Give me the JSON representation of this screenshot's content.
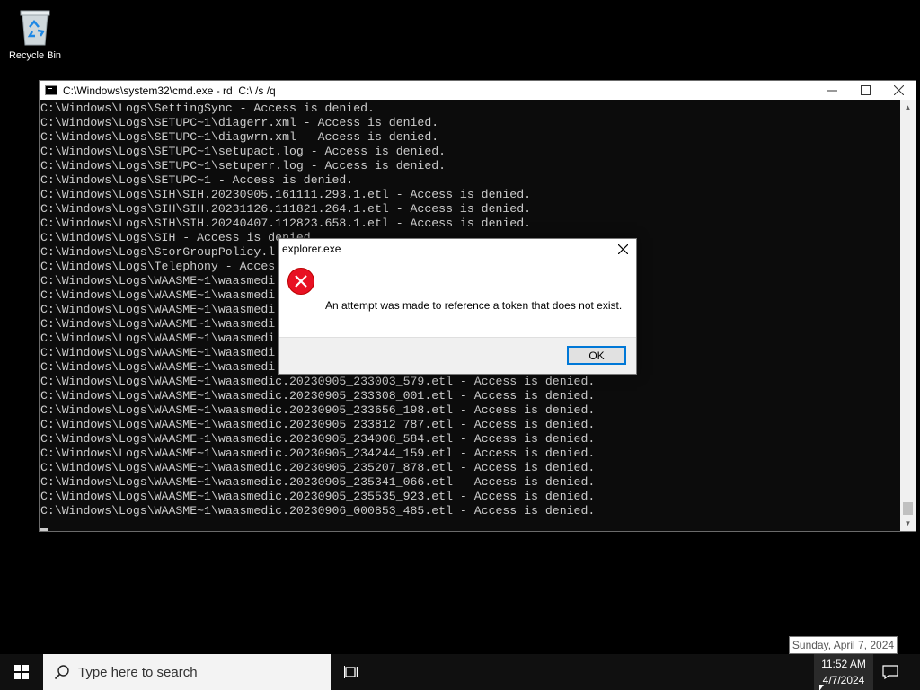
{
  "desktop": {
    "recycle_bin_label": "Recycle Bin"
  },
  "cmd": {
    "title": "C:\\Windows\\system32\\cmd.exe - rd  C:\\ /s /q",
    "controls": {
      "minimize_icon": "minimize-icon",
      "maximize_icon": "maximize-icon",
      "close_icon": "close-icon"
    },
    "lines": [
      "C:\\Windows\\Logs\\SettingSync - Access is denied.",
      "C:\\Windows\\Logs\\SETUPC~1\\diagerr.xml - Access is denied.",
      "C:\\Windows\\Logs\\SETUPC~1\\diagwrn.xml - Access is denied.",
      "C:\\Windows\\Logs\\SETUPC~1\\setupact.log - Access is denied.",
      "C:\\Windows\\Logs\\SETUPC~1\\setuperr.log - Access is denied.",
      "C:\\Windows\\Logs\\SETUPC~1 - Access is denied.",
      "C:\\Windows\\Logs\\SIH\\SIH.20230905.161111.293.1.etl - Access is denied.",
      "C:\\Windows\\Logs\\SIH\\SIH.20231126.111821.264.1.etl - Access is denied.",
      "C:\\Windows\\Logs\\SIH\\SIH.20240407.112823.658.1.etl - Access is denied.",
      "C:\\Windows\\Logs\\SIH - Access is denied.",
      "C:\\Windows\\Logs\\StorGroupPolicy.l",
      "C:\\Windows\\Logs\\Telephony - Acces",
      "C:\\Windows\\Logs\\WAASME~1\\waasmedi",
      "C:\\Windows\\Logs\\WAASME~1\\waasmedi",
      "C:\\Windows\\Logs\\WAASME~1\\waasmedi",
      "C:\\Windows\\Logs\\WAASME~1\\waasmedi",
      "C:\\Windows\\Logs\\WAASME~1\\waasmedi",
      "C:\\Windows\\Logs\\WAASME~1\\waasmedi",
      "C:\\Windows\\Logs\\WAASME~1\\waasmedi",
      "C:\\Windows\\Logs\\WAASME~1\\waasmedic.20230905_233003_579.etl - Access is denied.",
      "C:\\Windows\\Logs\\WAASME~1\\waasmedic.20230905_233308_001.etl - Access is denied.",
      "C:\\Windows\\Logs\\WAASME~1\\waasmedic.20230905_233656_198.etl - Access is denied.",
      "C:\\Windows\\Logs\\WAASME~1\\waasmedic.20230905_233812_787.etl - Access is denied.",
      "C:\\Windows\\Logs\\WAASME~1\\waasmedic.20230905_234008_584.etl - Access is denied.",
      "C:\\Windows\\Logs\\WAASME~1\\waasmedic.20230905_234244_159.etl - Access is denied.",
      "C:\\Windows\\Logs\\WAASME~1\\waasmedic.20230905_235207_878.etl - Access is denied.",
      "C:\\Windows\\Logs\\WAASME~1\\waasmedic.20230905_235341_066.etl - Access is denied.",
      "C:\\Windows\\Logs\\WAASME~1\\waasmedic.20230905_235535_923.etl - Access is denied.",
      "C:\\Windows\\Logs\\WAASME~1\\waasmedic.20230906_000853_485.etl - Access is denied."
    ]
  },
  "dialog": {
    "title": "explorer.exe",
    "message": "An attempt was made to reference a token that does not exist.",
    "ok_label": "OK",
    "icon": "error-icon",
    "accent_color": "#0078d7",
    "error_color": "#e81123"
  },
  "tooltip": {
    "text": "Sunday, April 7, 2024"
  },
  "taskbar": {
    "search_placeholder": "Type here to search",
    "time": "11:52 AM",
    "date": "4/7/2024"
  }
}
